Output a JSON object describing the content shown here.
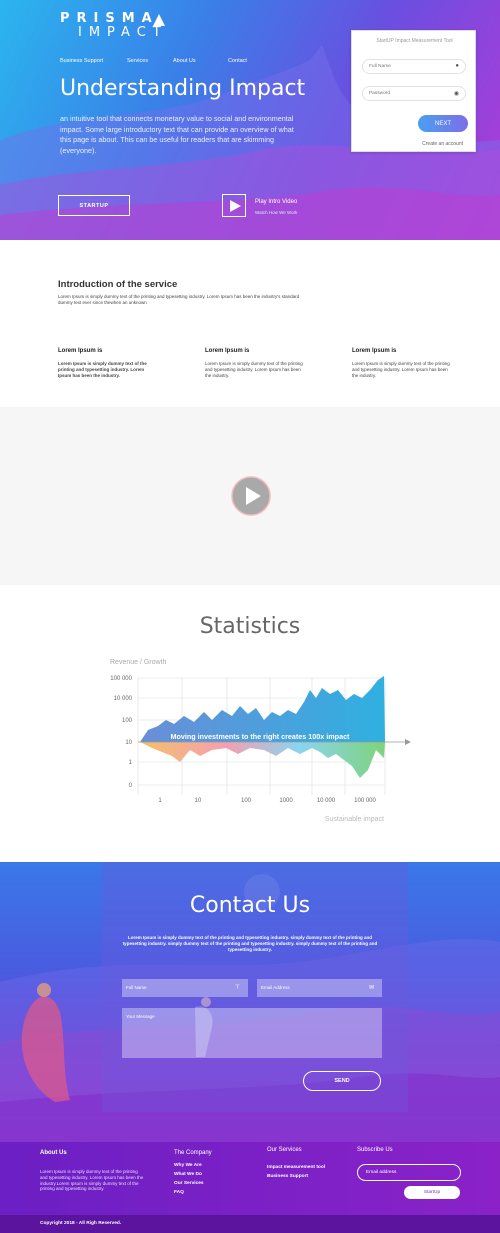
{
  "brand": {
    "line1": "PRISMA",
    "line2": "IMPACT"
  },
  "nav": [
    "Business Support",
    "Services",
    "About Us",
    "Contact"
  ],
  "hero": {
    "title": "Understanding Impact",
    "intro": "an intuitive tool that connects monetary value to social and environmental impact. Some large introductory text that can provide an overview of what this page is about. This can be useful for readers that are skimming (everyone).",
    "startup_label": "STARTUP",
    "play_label": "Play Intro Video",
    "play_sub": "Watch How We Work"
  },
  "form": {
    "title": "StartUP Impact Measurement Tool",
    "full_name": "Full Name",
    "password": "Password",
    "next": "NEXT",
    "create": "Create an account"
  },
  "intro": {
    "title": "Introduction of the  service",
    "desc": "Lorem Ipsum is simply dummy text of the printing and typesetting industry. Lorem Ipsum has been the industry's standard dummy text ever since thewhen an unknown",
    "cols": [
      {
        "title": "Lorem Ipsum is",
        "text": "Lorem Ipsum is simply dummy text of the printing and typesetting industry. Lorem Ipsum has been the industry."
      },
      {
        "title": "Lorem Ipsum is",
        "text": "Lorem Ipsum is simply dummy text of the printing and typesetting industry. Lorem Ipsum has been the industry."
      },
      {
        "title": "Lorem Ipsum is",
        "text": "Lorem Ipsum is simply dummy text of the printing and typesetting industry. Lorem Ipsum has been the industry."
      }
    ]
  },
  "stats": {
    "title": "Statistics"
  },
  "chart_data": {
    "type": "area",
    "title": "Revenue / Growth",
    "xlabel": "Sustainable impact",
    "annotation": "Moving investments to the right creates 100x impact",
    "x_ticks": [
      "1",
      "10",
      "100",
      "1000",
      "10 000",
      "100 000"
    ],
    "y_ticks": [
      "100 000",
      "10 000",
      "100",
      "10",
      "1",
      "0"
    ],
    "colors": {
      "upper_start": "#6a8ed8",
      "upper_end": "#2fb0e0",
      "lower_start": "#f4c06a",
      "lower_end": "#7fd37a"
    }
  },
  "contact": {
    "title": "Contact Us",
    "desc": "Lorem Ipsum is simply dummy text of the printing and typesetting industry. simply dummy text of the printing and typesetting industry. simply dummy text of the printing and typesetting industry. simply dummy text of the printing and typesetting industry.",
    "full_name": "Full Name",
    "email": "Email Address",
    "message": "Your Message",
    "send": "SEND"
  },
  "footer": {
    "about_title": "About Us",
    "about_text": "Lorem Ipsum is simply dummy text of the printing and typesetting industry. Lorem Ipsum has been the industry.Lorem Ipsum is simply dummy text of the printing and typesetting industry.",
    "company_title": "The Company",
    "company_links": [
      "Why We Are",
      "What We Do",
      "Our Services",
      "FAQ"
    ],
    "services_title": "Our Services",
    "services_links": [
      "Impact measurement tool",
      "Business Support"
    ],
    "subscribe_title": "Subscribe Us",
    "email_placeholder": "Email address",
    "subscribe_btn": "StartUp",
    "copyright": "Copyright 2018 - All Righ Reserved."
  }
}
